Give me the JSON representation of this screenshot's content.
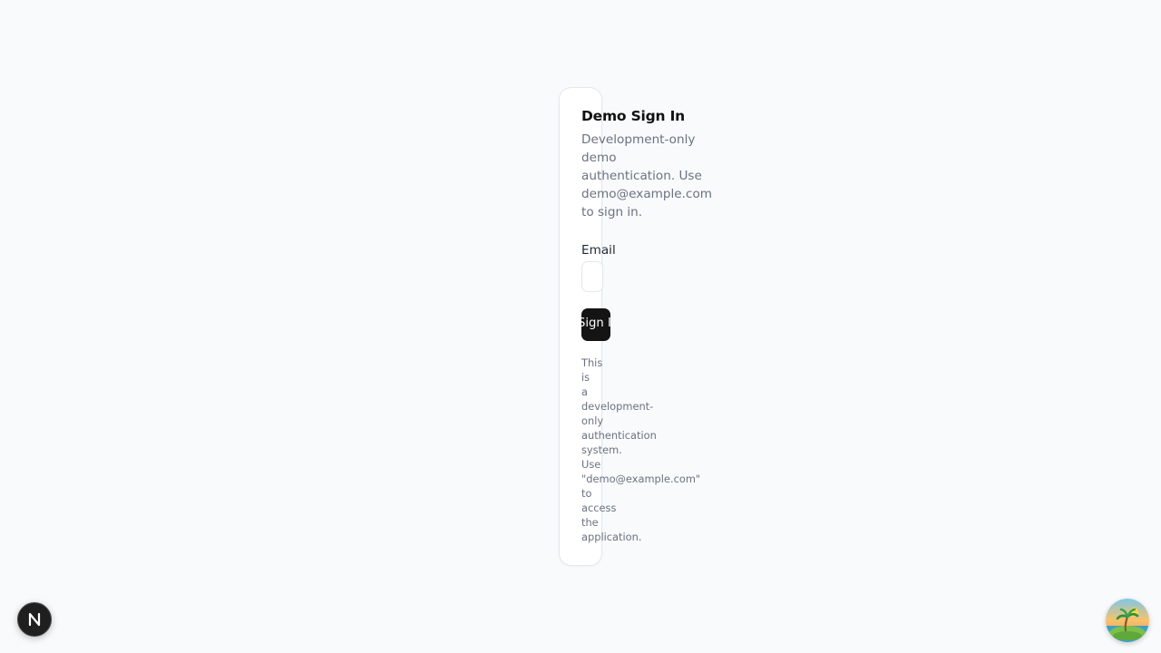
{
  "card": {
    "title": "Demo Sign In",
    "description_lines": [
      "Development-only",
      "demo",
      "authentication. Use",
      "demo@example.com",
      "to sign in."
    ],
    "email_label": "Email",
    "email_value": "",
    "signin_button_label": "Sign In",
    "note_lines": [
      "This",
      "is",
      "a",
      "development-",
      "only",
      "authentication",
      "system.",
      "Use",
      "\"demo@example.com\"",
      "to",
      "access",
      "the",
      "application."
    ]
  },
  "dev_indicator": {
    "letter": "N",
    "icon": "nextjs-logo-icon"
  },
  "avatar": {
    "icon": "island-palm-avatar-icon"
  },
  "colors": {
    "page_bg": "#f8fafc",
    "card_bg": "#ffffff",
    "button_bg": "#141414",
    "muted_text": "#6b7280"
  }
}
